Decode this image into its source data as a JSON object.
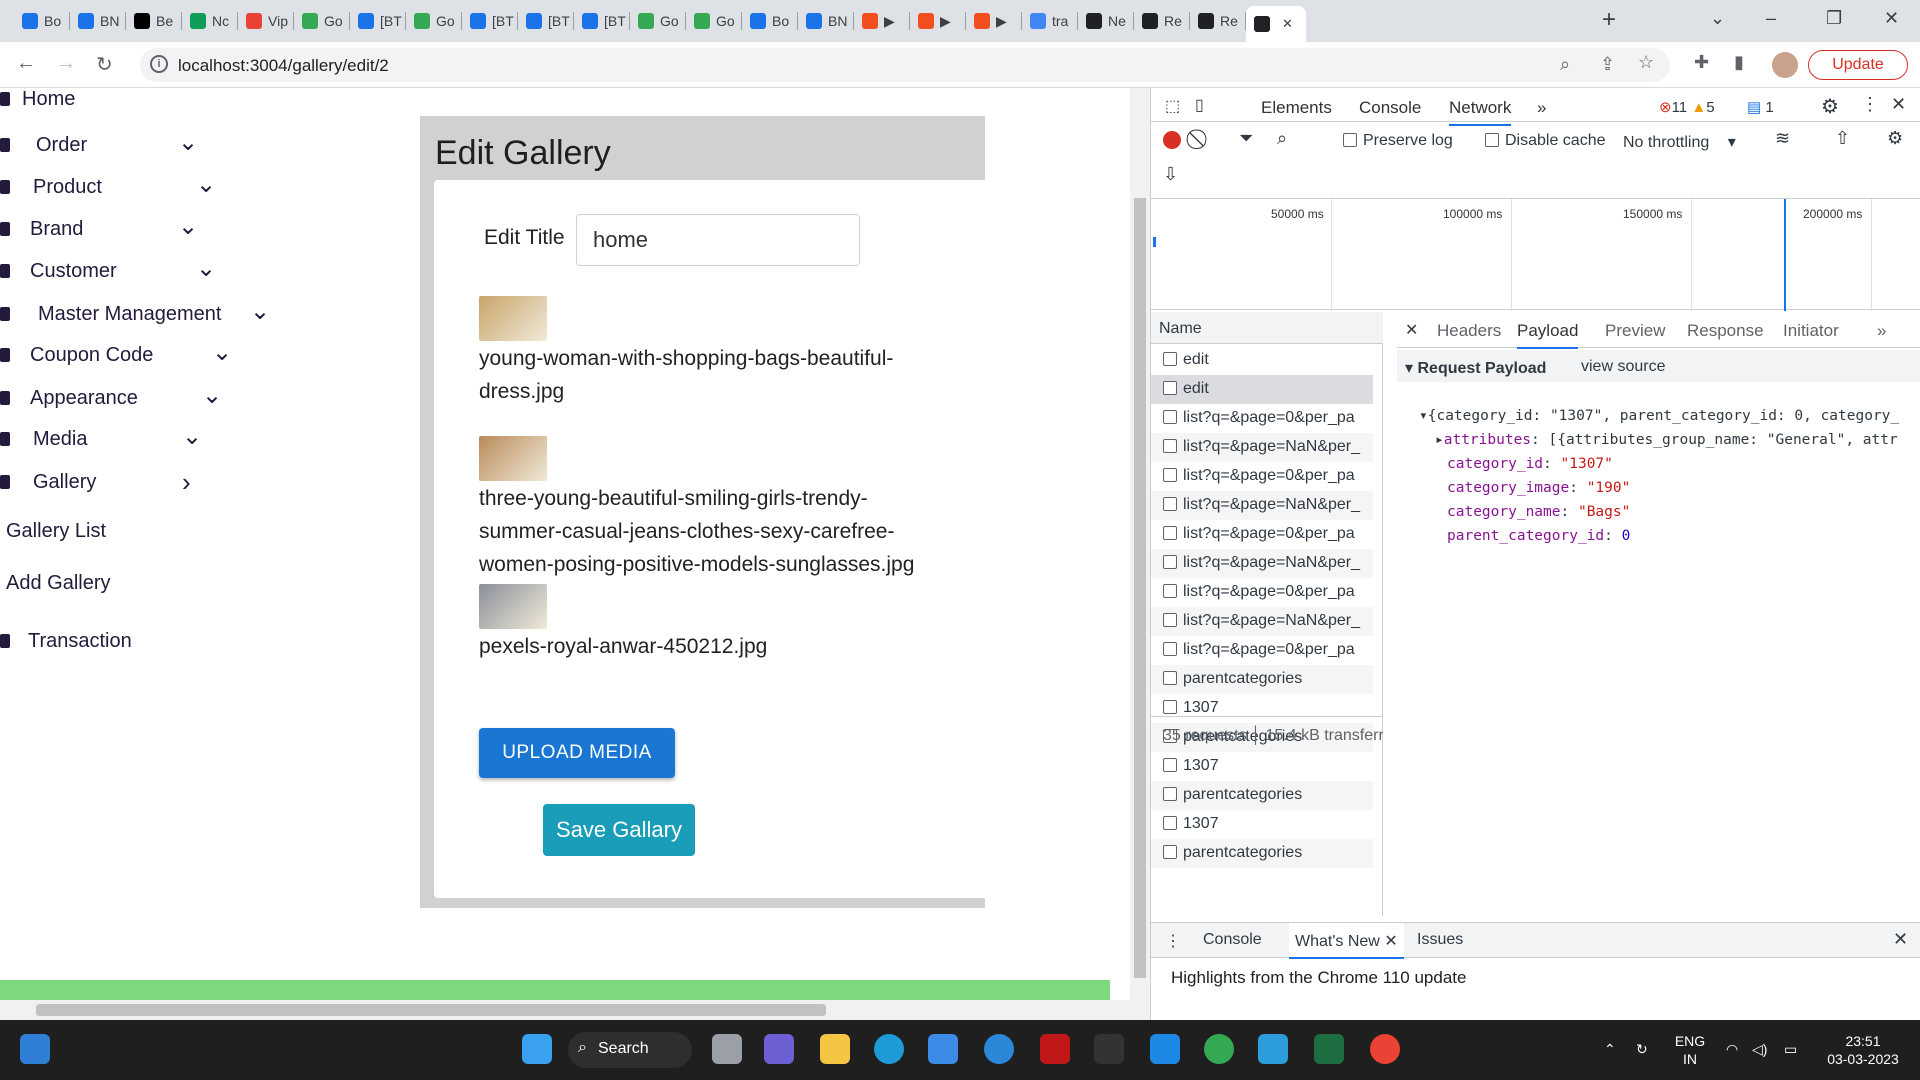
{
  "browser": {
    "tabs": [
      {
        "label": "Bo",
        "color": "#1a73e8"
      },
      {
        "label": "BN",
        "color": "#1a73e8"
      },
      {
        "label": "Be",
        "color": "#000000",
        "prefix": "JF"
      },
      {
        "label": "Nc",
        "color": "#0f9d58"
      },
      {
        "label": "Vip",
        "color": "#ea4335"
      },
      {
        "label": "Go",
        "color": "#34a853"
      },
      {
        "label": "[BT",
        "color": "#1a73e8"
      },
      {
        "label": "Go",
        "color": "#34a853"
      },
      {
        "label": "[BT",
        "color": "#1a73e8"
      },
      {
        "label": "[BT",
        "color": "#1a73e8"
      },
      {
        "label": "[BT",
        "color": "#1a73e8"
      },
      {
        "label": "Go",
        "color": "#34a853"
      },
      {
        "label": "Go",
        "color": "#34a853"
      },
      {
        "label": "Bo",
        "color": "#1a73e8"
      },
      {
        "label": "BN",
        "color": "#1a73e8"
      },
      {
        "label": "▶",
        "color": "#f24e1e"
      },
      {
        "label": "▶",
        "color": "#f24e1e"
      },
      {
        "label": "▶",
        "color": "#f24e1e"
      },
      {
        "label": "tra",
        "color": "#4285f4"
      },
      {
        "label": "Ne",
        "color": "#202124"
      },
      {
        "label": "Re",
        "color": "#202124"
      },
      {
        "label": "Re",
        "color": "#202124"
      },
      {
        "label": "",
        "color": "#202124"
      }
    ],
    "url": "localhost:3004/gallery/edit/2",
    "update_label": "Update",
    "new_tab": "+",
    "close_tab": "✕"
  },
  "sidebar": {
    "items": [
      {
        "label": "Home",
        "chevron": ""
      },
      {
        "label": "Order",
        "chevron": "⌄"
      },
      {
        "label": "Product",
        "chevron": "⌄"
      },
      {
        "label": "Brand",
        "chevron": "⌄"
      },
      {
        "label": "Customer",
        "chevron": "⌄"
      },
      {
        "label": "Master Management",
        "chevron": "⌄"
      },
      {
        "label": "Coupon Code",
        "chevron": "⌄"
      },
      {
        "label": "Appearance",
        "chevron": "⌄"
      },
      {
        "label": "Media",
        "chevron": "⌄"
      },
      {
        "label": "Gallery",
        "chevron": "›"
      },
      {
        "label": "Gallery List",
        "chevron": ""
      },
      {
        "label": "Add Gallery",
        "chevron": ""
      },
      {
        "label": "Transaction",
        "chevron": ""
      }
    ]
  },
  "gallery": {
    "heading": "Edit Gallery",
    "title_label": "Edit Title",
    "title_value": "home",
    "files": [
      {
        "name": "young-woman-with-shopping-bags-beautiful-dress.jpg",
        "thumb_color": "#c8a46a"
      },
      {
        "name": "three-young-beautiful-smiling-girls-trendy-summer-casual-jeans-clothes-sexy-carefree-women-posing-positive-models-sunglasses.jpg",
        "thumb_color": "#b98a5a"
      },
      {
        "name": "pexels-royal-anwar-450212.jpg",
        "thumb_color": "#8a8f99"
      }
    ],
    "upload_label": "UPLOAD MEDIA",
    "save_label": "Save Gallary"
  },
  "devtools": {
    "tabs": [
      "Elements",
      "Console",
      "Network"
    ],
    "more": "»",
    "errors": "11",
    "warnings": "5",
    "messages": "1",
    "toolbar": {
      "preserve_log": "Preserve log",
      "disable_cache": "Disable cache",
      "throttling": "No throttling"
    },
    "timeline_labels": [
      "50000 ms",
      "100000 ms",
      "150000 ms",
      "200000 ms"
    ],
    "name_header": "Name",
    "requests": [
      "edit",
      "edit",
      "list?q=&page=0&per_pa",
      "list?q=&page=NaN&per_",
      "list?q=&page=0&per_pa",
      "list?q=&page=NaN&per_",
      "list?q=&page=0&per_pa",
      "list?q=&page=NaN&per_",
      "list?q=&page=0&per_pa",
      "list?q=&page=NaN&per_",
      "list?q=&page=0&per_pa",
      "parentcategories",
      "1307",
      "parentcategories",
      "1307",
      "parentcategories",
      "1307",
      "parentcategories"
    ],
    "footer_requests": "35 requests",
    "footer_transfer": "15.4 kB transferr",
    "detail_tabs": [
      "Headers",
      "Payload",
      "Preview",
      "Response",
      "Initiator"
    ],
    "payload_title": "Request Payload",
    "view_source": "view source",
    "payload": {
      "summary": "{category_id: \"1307\", parent_category_id: 0, category_",
      "attributes": "[{attributes_group_name: \"General\", attr",
      "category_id": "\"1307\"",
      "category_image": "\"190\"",
      "category_name": "\"Bags\"",
      "parent_category_id": "0"
    },
    "drawer_tabs": [
      "Console",
      "What's New",
      "Issues"
    ],
    "drawer_text": "Highlights from the Chrome 110 update"
  },
  "taskbar": {
    "search_label": "Search",
    "lang": "ENG",
    "region": "IN",
    "time": "23:51",
    "date": "03-03-2023"
  }
}
